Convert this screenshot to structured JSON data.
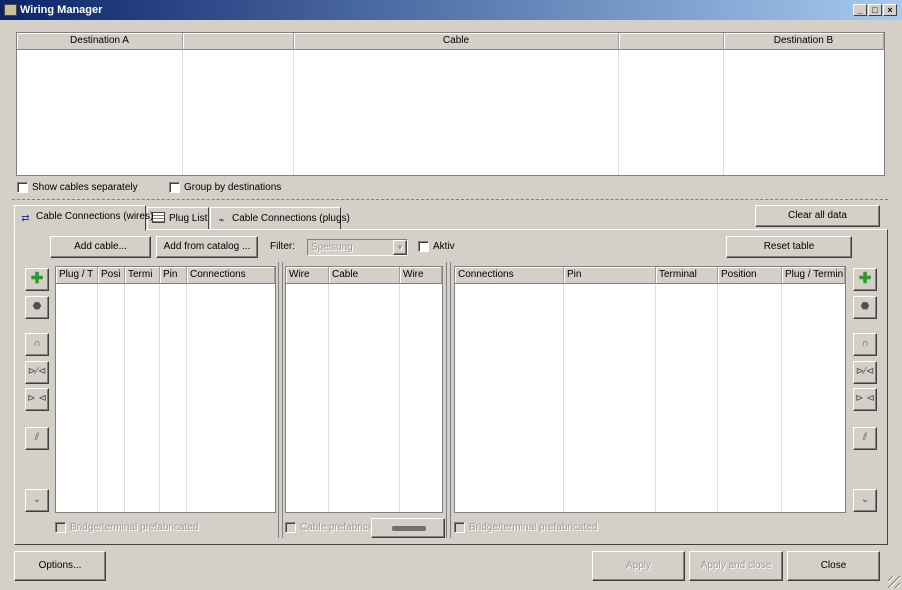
{
  "window": {
    "title": "Wiring Manager",
    "min_glyph": "_",
    "max_glyph": "□",
    "close_glyph": "×"
  },
  "top_table": {
    "columns": [
      "Destination A",
      "",
      "Cable",
      "",
      "Destination B"
    ]
  },
  "options": {
    "show_cables_separately": "Show cables separately",
    "group_by_destinations": "Group by destinations"
  },
  "tabs": [
    {
      "label": "Cable Connections (wires)",
      "icon": "cable-connections-icon"
    },
    {
      "label": "Plug List",
      "icon": "table-grid-icon"
    },
    {
      "label": "Cable Connections (plugs)",
      "icon": "plug-connections-icon"
    }
  ],
  "toolbar": {
    "clear_all_data": "Clear all data",
    "add_cable": "Add cable...",
    "add_from_catalog": "Add from catalog ...",
    "filter_label": "Filter:",
    "filter_value": "Speisung",
    "aktiv_label": "Aktiv",
    "reset_table": "Reset table"
  },
  "left_table": {
    "columns": [
      "Plug / T",
      "Posi",
      "Termi",
      "Pin",
      "Connections"
    ],
    "footer": "Bridge/terminal prefabricated"
  },
  "middle_table": {
    "columns": [
      "Wire",
      "Cable",
      "Wire"
    ],
    "footer": "Cable prefabricate"
  },
  "right_table": {
    "columns": [
      "Connections",
      "Pin",
      "Terminal",
      "Position",
      "Plug / Termin"
    ],
    "footer": "Bridge/terminal prefabricated"
  },
  "side_tools": [
    "add-icon",
    "remove-plug-icon",
    "headphone-connector-icon",
    "connect-icon",
    "disconnect-icon",
    "wire-tool-icon",
    "scroll-down-icon"
  ],
  "footer": {
    "options": "Options...",
    "apply": "Apply",
    "apply_and_close": "Apply and close",
    "close": "Close"
  },
  "colors": {
    "title_start": "#0a246a",
    "title_end": "#a6caf0",
    "face": "#d4d0c8",
    "add_green": "#2a9a2a"
  }
}
